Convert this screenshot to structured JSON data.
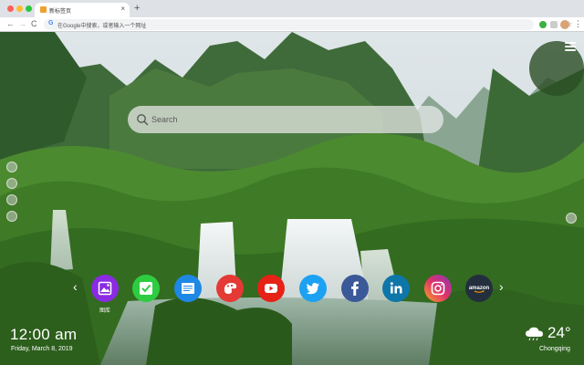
{
  "browser": {
    "tab_title": "新标签页",
    "tab_close": "×",
    "new_tab": "+",
    "omnibox_placeholder": "在Google中搜索，或者输入一个网址",
    "nav_back": "←",
    "nav_forward": "→",
    "nav_reload": "C",
    "star": "☆",
    "menu": "⋮"
  },
  "search": {
    "placeholder": "Search"
  },
  "shortcuts": [
    {
      "icon": "image-gallery-icon",
      "color": "#8a2be2",
      "label": "图库"
    },
    {
      "icon": "checkmark-icon",
      "color": "#2ecc40",
      "label": ""
    },
    {
      "icon": "notes-icon",
      "color": "#1e88e5",
      "label": ""
    },
    {
      "icon": "palette-icon",
      "color": "#e53935",
      "label": ""
    },
    {
      "icon": "youtube-icon",
      "color": "#e62117",
      "label": ""
    },
    {
      "icon": "twitter-icon",
      "color": "#1da1f2",
      "label": ""
    },
    {
      "icon": "facebook-icon",
      "color": "#3b5998",
      "label": ""
    },
    {
      "icon": "linkedin-icon",
      "color": "#0e76a8",
      "label": ""
    },
    {
      "icon": "instagram-icon",
      "color": "#c13584",
      "label": ""
    },
    {
      "icon": "amazon-icon",
      "color": "#232f3e",
      "label": "amazon"
    }
  ],
  "nav_arrows": {
    "left": "‹",
    "right": "›"
  },
  "clock": {
    "time": "12:00 am",
    "date": "Friday, March 8, 2019"
  },
  "weather": {
    "temperature": "24°",
    "city": "Chongqing",
    "icon": "cloud-rain-icon"
  }
}
